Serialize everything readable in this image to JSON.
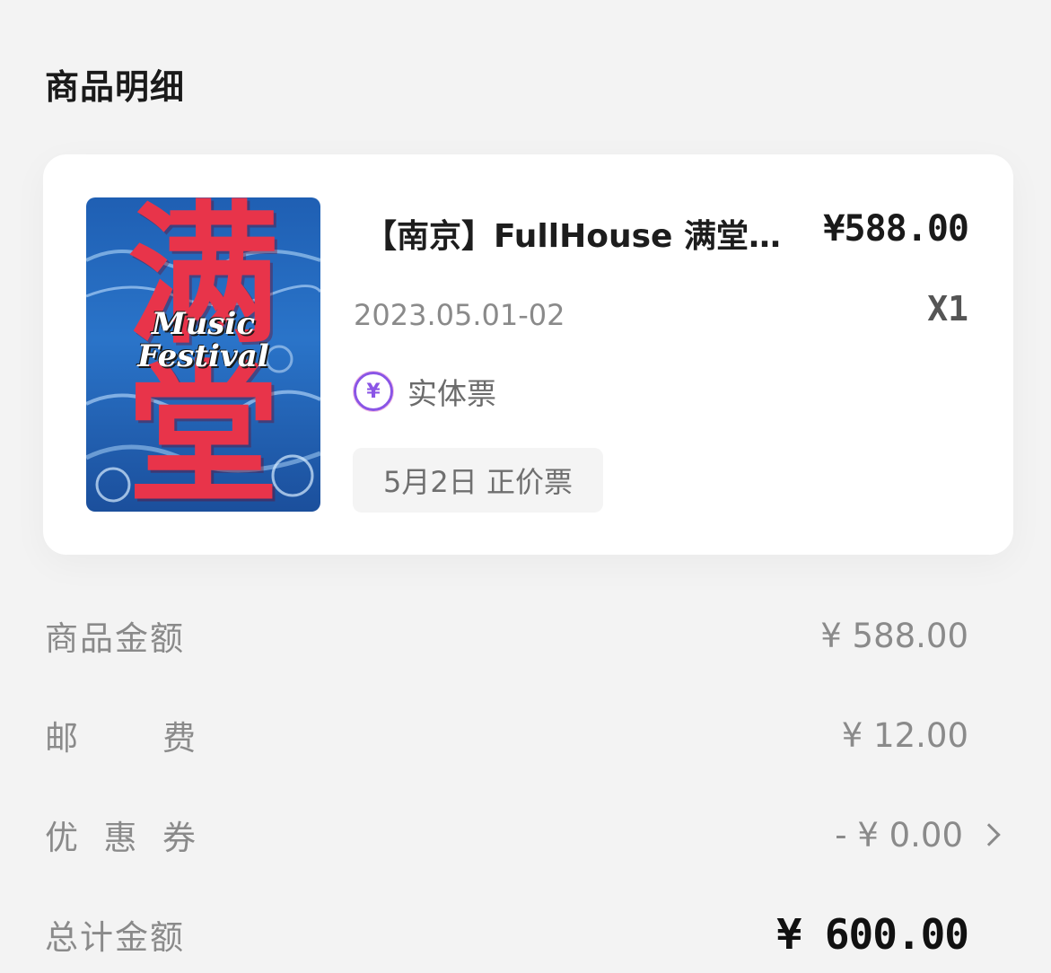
{
  "section": {
    "title": "商品明细"
  },
  "product": {
    "poster": {
      "char_top": "满",
      "char_bottom": "堂",
      "tag_line_1": "Music",
      "tag_line_2": "Festival"
    },
    "name": "【南京】FullHouse 满堂…",
    "price": "¥588.00",
    "date": "2023.05.01-02",
    "quantity": "X1",
    "ticket_type_icon": "¥",
    "ticket_type": "实体票",
    "session": "5月2日 正价票"
  },
  "summary": {
    "amount_label": "商品金额",
    "amount_value": "¥ 588.00",
    "shipping_label_1": "邮",
    "shipping_label_2": "费",
    "shipping_value": "¥ 12.00",
    "coupon_label_1": "优",
    "coupon_label_2": "惠",
    "coupon_label_3": "券",
    "coupon_value": "- ¥ 0.00",
    "total_label": "总计金额",
    "total_value": "¥ 600.00"
  },
  "colors": {
    "background": "#f3f3f3",
    "card": "#ffffff",
    "poster_red": "#e8344a",
    "poster_blue": "#2a74c9",
    "ticket_icon": "#8a55e6"
  }
}
